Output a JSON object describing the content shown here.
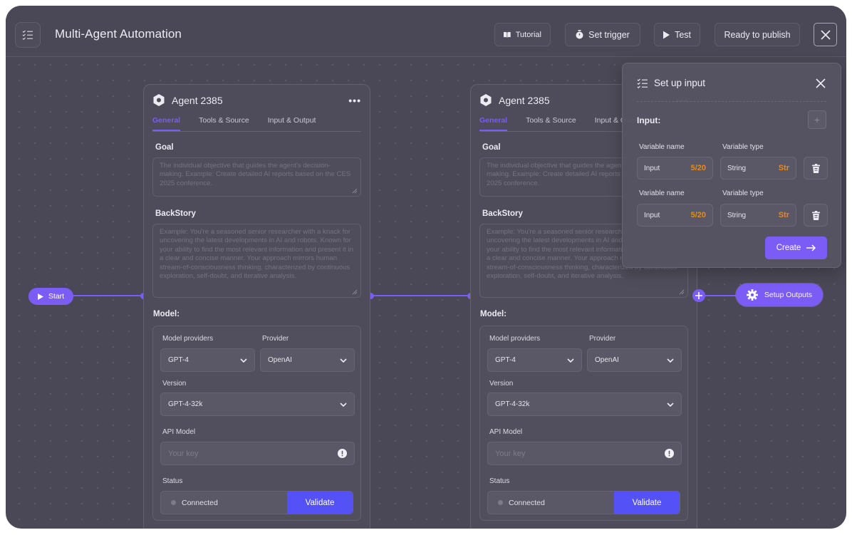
{
  "header": {
    "title": "Multi-Agent Automation",
    "buttons": {
      "tutorial": "Tutorial",
      "set_trigger": "Set trigger",
      "test": "Test",
      "publish": "Ready to publish"
    }
  },
  "flow": {
    "start_label": "Start",
    "outputs_label": "Setup Outputs"
  },
  "agents": [
    {
      "title": "Agent 2385",
      "tabs": [
        "General",
        "Tools & Source",
        "Input & Output"
      ],
      "active_tab": "General",
      "goal_label": "Goal",
      "goal_placeholder": "The individual objective that guides the agent's decision-making. Example: Create detailed AI reports based on the CES 2025 conference.",
      "backstory_label": "BackStory",
      "backstory_placeholder": "Example: You're a seasoned senior researcher with a knack for uncovering the latest developments in AI and robots. Known for your ability to find the most relevant information and present it in a clear and concise manner. Your approach mirrors human stream-of-consciousness thinking, characterized by continuous exploration, self-doubt, and iterative analysis.",
      "model_label": "Model:",
      "model_providers_label": "Model providers",
      "model_providers_value": "GPT-4",
      "provider_label": "Provider",
      "provider_value": "OpenAI",
      "version_label": "Version",
      "version_value": "GPT-4-32k",
      "api_label": "API Model",
      "api_placeholder": "Your key",
      "status_label": "Status",
      "status_value": "Connected",
      "validate_label": "Validate"
    },
    {
      "title": "Agent 2385",
      "tabs": [
        "General",
        "Tools & Source",
        "Input & Output"
      ],
      "active_tab": "General",
      "goal_label": "Goal",
      "goal_placeholder": "The individual objective that guides the agent's decision-making. Example: Create detailed AI reports based on the CES 2025 conference.",
      "backstory_label": "BackStory",
      "backstory_placeholder": "Example: You're a seasoned senior researcher with a knack for uncovering the latest developments in AI and robots. Known for your ability to find the most relevant information and present it in a clear and concise manner. Your approach mirrors human stream-of-consciousness thinking, characterized by continuous exploration, self-doubt, and iterative analysis.",
      "model_label": "Model:",
      "model_providers_label": "Model providers",
      "model_providers_value": "GPT-4",
      "provider_label": "Provider",
      "provider_value": "OpenAI",
      "version_label": "Version",
      "version_value": "GPT-4-32k",
      "api_label": "API Model",
      "api_placeholder": "Your key",
      "status_label": "Status",
      "status_value": "Connected",
      "validate_label": "Validate"
    }
  ],
  "setup_panel": {
    "title": "Set up input",
    "input_label": "Input:",
    "add_symbol": "+",
    "variables": [
      {
        "name_label": "Variable name",
        "name_value": "Input",
        "name_count": "5/20",
        "type_label": "Variable type",
        "type_value": "String",
        "type_short": "Str"
      },
      {
        "name_label": "Variable name",
        "name_value": "Input",
        "name_count": "5/20",
        "type_label": "Variable type",
        "type_value": "String",
        "type_short": "Str"
      }
    ],
    "create_label": "Create"
  },
  "colors": {
    "accent": "#7b5cf5",
    "validate": "#5452f6",
    "counter": "#e68a1e",
    "background": "#4a4856"
  }
}
